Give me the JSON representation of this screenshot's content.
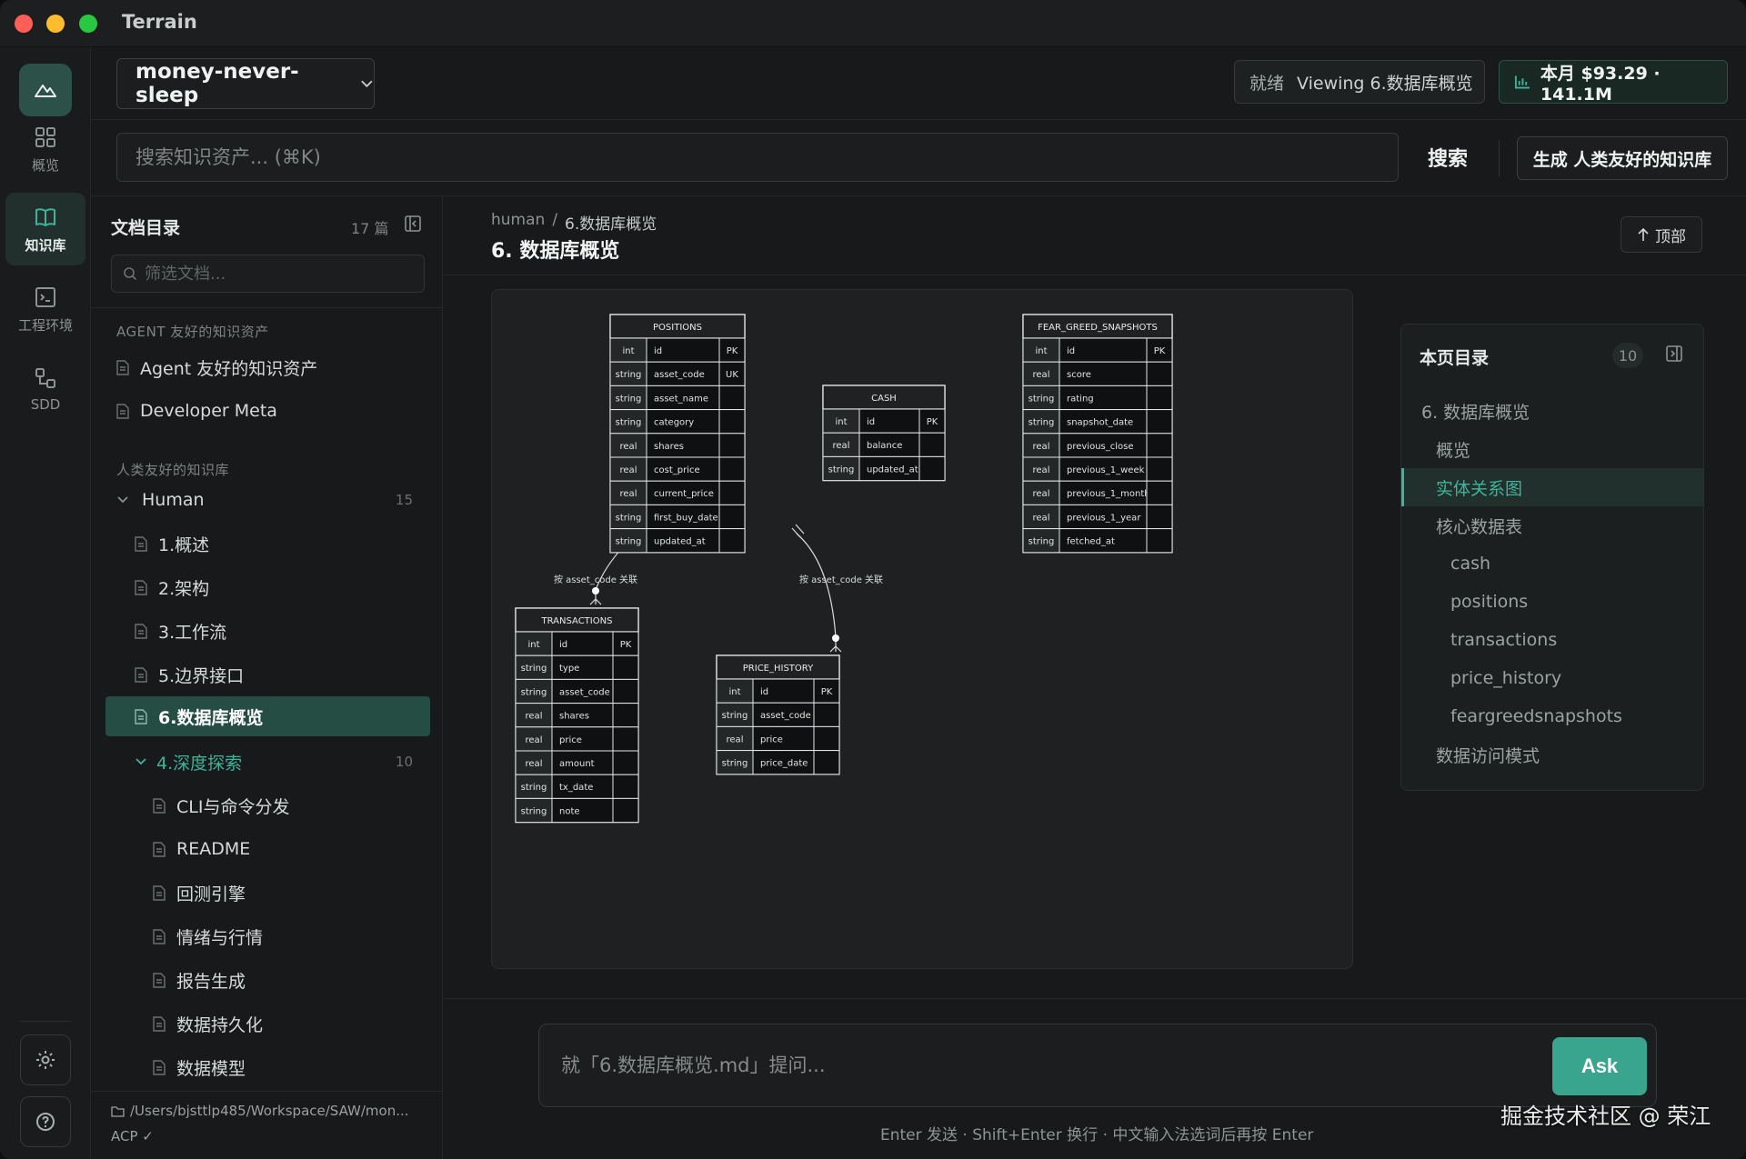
{
  "app": {
    "title": "Terrain"
  },
  "rail": {
    "items": [
      {
        "label": "概览",
        "icon": "grid-icon"
      },
      {
        "label": "知识库",
        "icon": "book-icon",
        "active": true
      },
      {
        "label": "工程环境",
        "icon": "terminal-icon"
      },
      {
        "label": "SDD",
        "icon": "flow-icon"
      }
    ]
  },
  "topbar": {
    "project": "money-never-sleep",
    "status_label": "就绪",
    "status_text": "Viewing 6.数据库概览",
    "usage": "本月 $93.29 · 141.1M"
  },
  "search": {
    "placeholder": "搜索知识资产... (⌘K)",
    "button": "搜索",
    "generate": "生成 人类友好的知识库"
  },
  "sidebar": {
    "title": "文档目录",
    "count": "17 篇",
    "filter_placeholder": "筛选文档...",
    "section_agent": "AGENT 友好的知识资产",
    "agent_items": [
      "Agent 友好的知识资产",
      "Developer Meta"
    ],
    "section_human": "人类友好的知识库",
    "group_human": {
      "label": "Human",
      "count": "15"
    },
    "human_items": [
      "1.概述",
      "2.架构",
      "3.工作流",
      "5.边界接口",
      "6.数据库概览"
    ],
    "group_deep": {
      "label": "4.深度探索",
      "count": "10"
    },
    "deep_items": [
      "CLI与命令分发",
      "README",
      "回测引擎",
      "情绪与行情",
      "报告生成",
      "数据持久化",
      "数据模型"
    ],
    "path": "/Users/bjsttlp485/Workspace/SAW/mon...",
    "acp": "ACP ✓"
  },
  "content": {
    "breadcrumb_root": "human",
    "breadcrumb_sep": "/",
    "breadcrumb_current": "6.数据库概览",
    "title": "6. 数据库概览",
    "top_button": "顶部"
  },
  "erd": {
    "tables": [
      {
        "name": "POSITIONS",
        "rows": [
          [
            "int",
            "id",
            "PK"
          ],
          [
            "string",
            "asset_code",
            "UK"
          ],
          [
            "string",
            "asset_name",
            ""
          ],
          [
            "string",
            "category",
            ""
          ],
          [
            "real",
            "shares",
            ""
          ],
          [
            "real",
            "cost_price",
            ""
          ],
          [
            "real",
            "current_price",
            ""
          ],
          [
            "string",
            "first_buy_date",
            ""
          ],
          [
            "string",
            "updated_at",
            ""
          ]
        ]
      },
      {
        "name": "CASH",
        "rows": [
          [
            "int",
            "id",
            "PK"
          ],
          [
            "real",
            "balance",
            ""
          ],
          [
            "string",
            "updated_at",
            ""
          ]
        ]
      },
      {
        "name": "FEAR_GREED_SNAPSHOTS",
        "rows": [
          [
            "int",
            "id",
            "PK"
          ],
          [
            "real",
            "score",
            ""
          ],
          [
            "string",
            "rating",
            ""
          ],
          [
            "string",
            "snapshot_date",
            ""
          ],
          [
            "real",
            "previous_close",
            ""
          ],
          [
            "real",
            "previous_1_week",
            ""
          ],
          [
            "real",
            "previous_1_month",
            ""
          ],
          [
            "real",
            "previous_1_year",
            ""
          ],
          [
            "string",
            "fetched_at",
            ""
          ]
        ]
      },
      {
        "name": "TRANSACTIONS",
        "rows": [
          [
            "int",
            "id",
            "PK"
          ],
          [
            "string",
            "type",
            ""
          ],
          [
            "string",
            "asset_code",
            ""
          ],
          [
            "real",
            "shares",
            ""
          ],
          [
            "real",
            "price",
            ""
          ],
          [
            "real",
            "amount",
            ""
          ],
          [
            "string",
            "tx_date",
            ""
          ],
          [
            "string",
            "note",
            ""
          ]
        ]
      },
      {
        "name": "PRICE_HISTORY",
        "rows": [
          [
            "int",
            "id",
            "PK"
          ],
          [
            "string",
            "asset_code",
            ""
          ],
          [
            "real",
            "price",
            ""
          ],
          [
            "string",
            "price_date",
            ""
          ]
        ]
      }
    ],
    "relation_label_1": "按 asset_code 关联",
    "relation_label_2": "按 asset_code 关联"
  },
  "toc": {
    "title": "本页目录",
    "count": "10",
    "items": [
      "6. 数据库概览",
      "概览",
      "实体关系图",
      "核心数据表",
      "cash",
      "positions",
      "transactions",
      "price_history",
      "feargreedsnapshots",
      "数据访问模式"
    ],
    "active": "实体关系图"
  },
  "ask": {
    "placeholder": "就「6.数据库概览.md」提问...",
    "button": "Ask",
    "hint": "Enter 发送 · Shift+Enter 换行 · 中文输入法选词后再按 Enter"
  },
  "watermark": "掘金技术社区 @ 荣江",
  "colors": {
    "accent": "#3aa58e",
    "active_bg": "#254d43"
  }
}
